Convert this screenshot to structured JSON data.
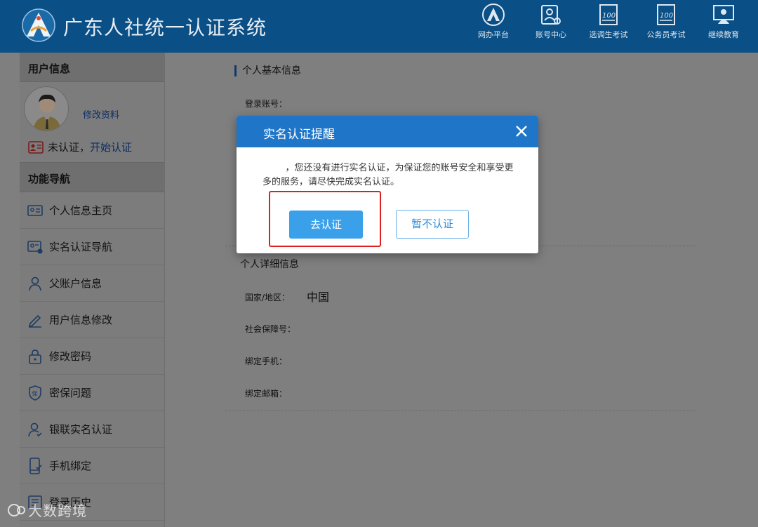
{
  "header": {
    "title": "广东人社统一认证系统",
    "nav": [
      {
        "label": "网办平台",
        "icon": "mountain-badge-icon"
      },
      {
        "label": "账号中心",
        "icon": "user-card-icon"
      },
      {
        "label": "选调生考试",
        "icon": "exam-paper-icon"
      },
      {
        "label": "公务员考试",
        "icon": "exam-paper-icon"
      },
      {
        "label": "继续教育",
        "icon": "teacher-board-icon"
      }
    ]
  },
  "sidebar": {
    "user_info_heading": "用户信息",
    "edit_profile": "修改资料",
    "auth_status": "未认证，",
    "auth_link": "开始认证",
    "nav_heading": "功能导航",
    "items": [
      {
        "label": "个人信息主页",
        "icon": "id-card-icon"
      },
      {
        "label": "实名认证导航",
        "icon": "verify-card-icon"
      },
      {
        "label": "父账户信息",
        "icon": "person-icon"
      },
      {
        "label": "用户信息修改",
        "icon": "pencil-icon"
      },
      {
        "label": "修改密码",
        "icon": "lock-icon"
      },
      {
        "label": "密保问题",
        "icon": "shield-icon"
      },
      {
        "label": "银联实名认证",
        "icon": "person-check-icon"
      },
      {
        "label": "手机绑定",
        "icon": "phone-icon"
      },
      {
        "label": "登录历史",
        "icon": "history-icon"
      }
    ]
  },
  "main": {
    "basic_info_title": "个人基本信息",
    "login_account_label": "登录账号：",
    "detail_title": "个人详细信息",
    "country_label": "国家/地区：",
    "country_value": "中国",
    "ssn_label": "社会保障号：",
    "phone_label": "绑定手机：",
    "email_label": "绑定邮箱："
  },
  "modal": {
    "title": "实名认证提醒",
    "message": "，您还没有进行实名认证，为保证您的账号安全和享受更多的服务，请尽快完成实名认证。",
    "confirm_label": "去认证",
    "cancel_label": "暂不认证"
  },
  "watermark": "大数跨境",
  "colors": {
    "header_bg": "#0a4f86",
    "modal_header": "#1f76c8",
    "primary_button": "#3aa0ea",
    "highlight": "#e02020",
    "overlay": "#7f7f7f"
  }
}
